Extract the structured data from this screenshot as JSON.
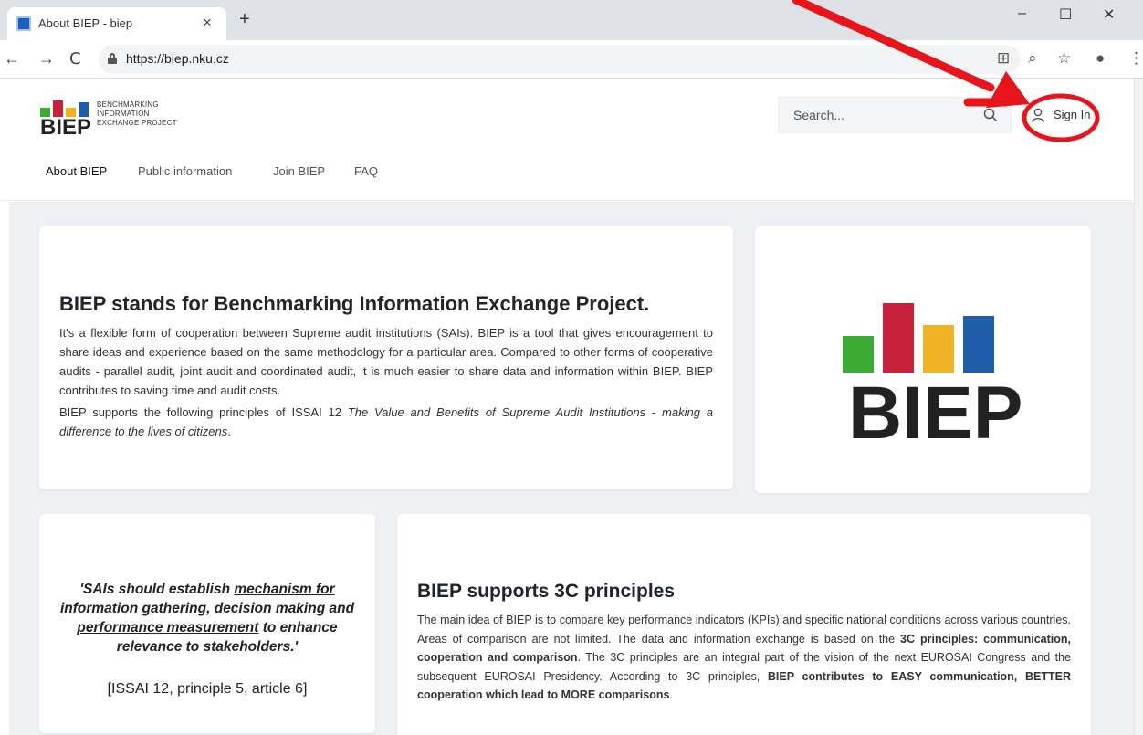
{
  "browser": {
    "tab": {
      "title": "About BIEP - biep",
      "close_glyph": "×"
    },
    "new_tab_glyph": "+",
    "window": {
      "minimize": "–",
      "maximize": "☐",
      "close": "✕"
    },
    "nav": {
      "back": "←",
      "forward": "→",
      "reload": "C"
    },
    "address": {
      "url": "https://biep.nku.cz"
    },
    "toolbar_glyphs": {
      "translate": "⊞",
      "zoom": "⌕",
      "bookmark": "☆",
      "profile": "●",
      "menu": "⋮"
    }
  },
  "header": {
    "logo": {
      "word": "BIEP",
      "subtitle_lines": [
        "BENCHMARKING",
        "INFORMATION",
        "EXCHANGE PROJECT"
      ],
      "bar_colors": [
        "#3aaa35",
        "#c8213c",
        "#f0b323",
        "#1f5da8"
      ]
    },
    "search": {
      "placeholder": "Search..."
    },
    "signin_label": "Sign In",
    "nav": [
      {
        "label": "About BIEP",
        "active": true
      },
      {
        "label": "Public information",
        "active": false
      },
      {
        "label": "Join BIEP",
        "active": false
      },
      {
        "label": "FAQ",
        "active": false
      }
    ]
  },
  "intro": {
    "heading": "BIEP stands for Benchmarking Information Exchange Project.",
    "paragraph1": "It's a flexible form of cooperation between Supreme audit institutions (SAIs). BIEP is a tool that gives encouragement to share ideas and experience based on the same methodology for a particular area. Compared to other forms of cooperative audits - parallel audit, joint audit and coordinated audit, it is much easier to share data and information within BIEP. BIEP contributes to saving time and audit costs.",
    "paragraph2_start": "BIEP supports the following principles of ISSAI 12 ",
    "paragraph2_italic": "The Value and Benefits of Supreme Audit Institutions - making a difference to the lives of citizens",
    "paragraph2_end": "."
  },
  "big_logo": {
    "word": "BIEP"
  },
  "quote": {
    "parts": [
      {
        "text": "'SAIs should establish ",
        "underline": false
      },
      {
        "text": "mechanism for information gathering",
        "underline": true
      },
      {
        "text": ", decision making and ",
        "underline": false
      },
      {
        "text": "performance measurement",
        "underline": true
      },
      {
        "text": " to enhance relevance to stakeholders.'",
        "underline": false
      }
    ],
    "citation": "[ISSAI 12, principle 5, article 6]"
  },
  "principles": {
    "heading": "BIEP supports 3C principles",
    "text_a": "The main idea of BIEP is to compare key performance indicators (KPIs) and specific national conditions across various countries. Areas of comparison are not limited. The data and information exchange is based on the ",
    "bold_a": "3C principles: communication, cooperation and comparison",
    "text_b": ". The 3C principles are an integral part of the vision of the next EUROSAI Congress and the subsequent EUROSAI Presidency. According to 3C principles, ",
    "bold_b": "BIEP contributes to EASY communication, BETTER cooperation which lead to MORE comparisons",
    "text_c": "."
  },
  "annotation": {
    "color": "#e8141c"
  }
}
